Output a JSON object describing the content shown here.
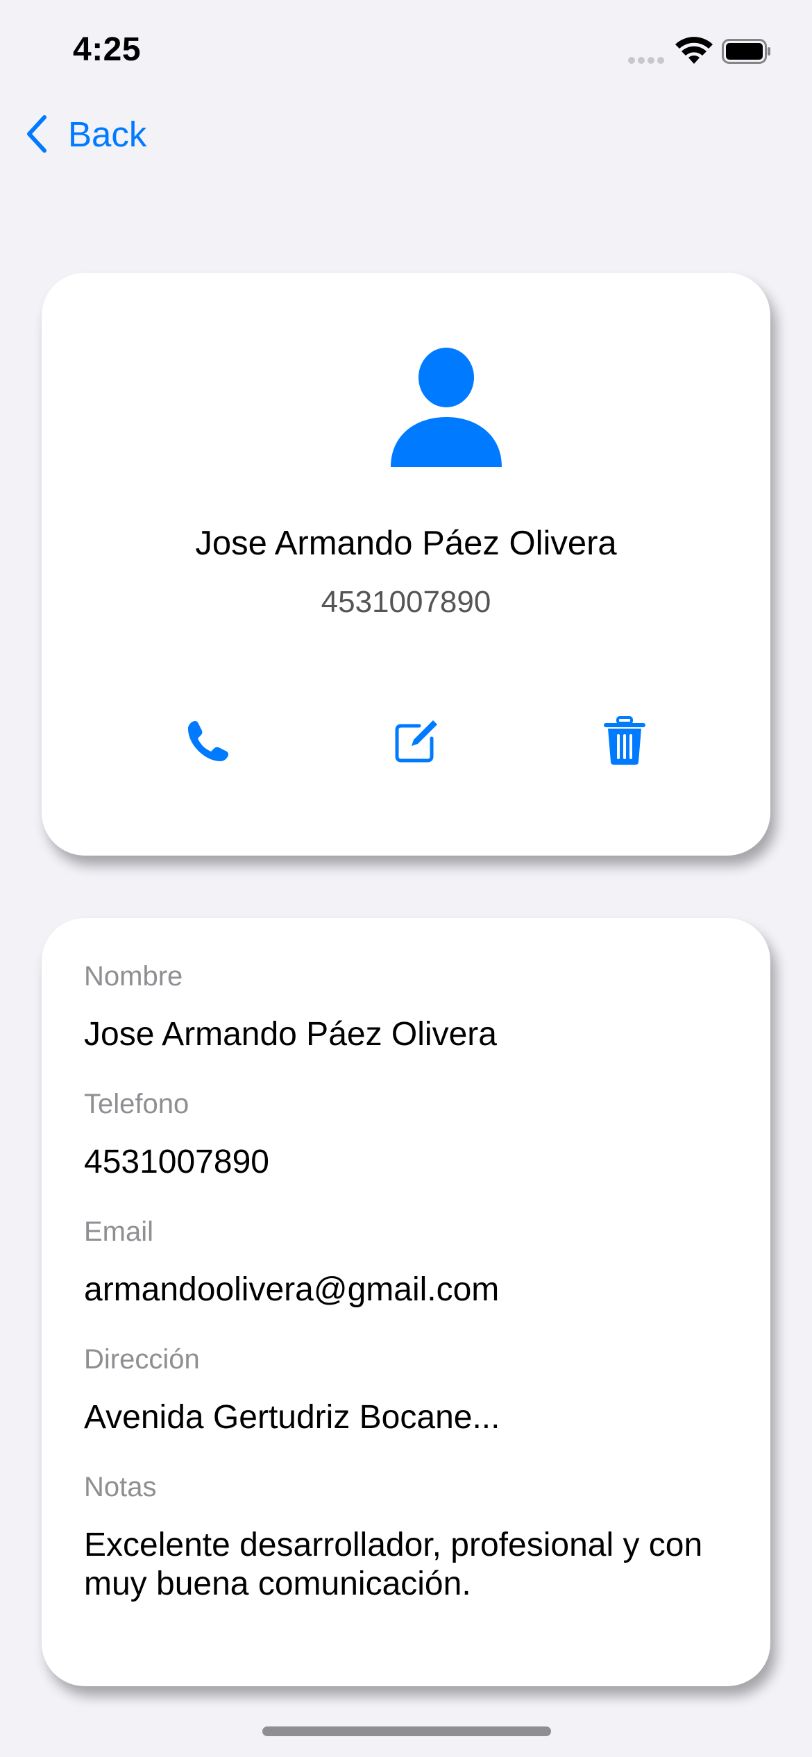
{
  "status_bar": {
    "time": "4:25"
  },
  "nav": {
    "back_label": "Back"
  },
  "contact": {
    "name": "Jose Armando Páez Olivera",
    "phone": "4531007890"
  },
  "actions": [
    {
      "name": "call",
      "icon": "phone-icon"
    },
    {
      "name": "edit",
      "icon": "edit-icon"
    },
    {
      "name": "delete",
      "icon": "trash-icon"
    }
  ],
  "details": {
    "name_label": "Nombre",
    "name_value": "Jose Armando Páez Olivera",
    "phone_label": "Telefono",
    "phone_value": "4531007890",
    "email_label": "Email",
    "email_value": "armandoolivera@gmail.com",
    "address_label": "Dirección",
    "address_value": "Avenida Gertudriz Bocane...",
    "notes_label": "Notas",
    "notes_value": "Excelente desarrollador, profesional y con muy buena comunicación."
  },
  "colors": {
    "accent": "#007aff",
    "background": "#f2f2f7",
    "card": "#ffffff",
    "secondary_text": "#8e8e93"
  }
}
